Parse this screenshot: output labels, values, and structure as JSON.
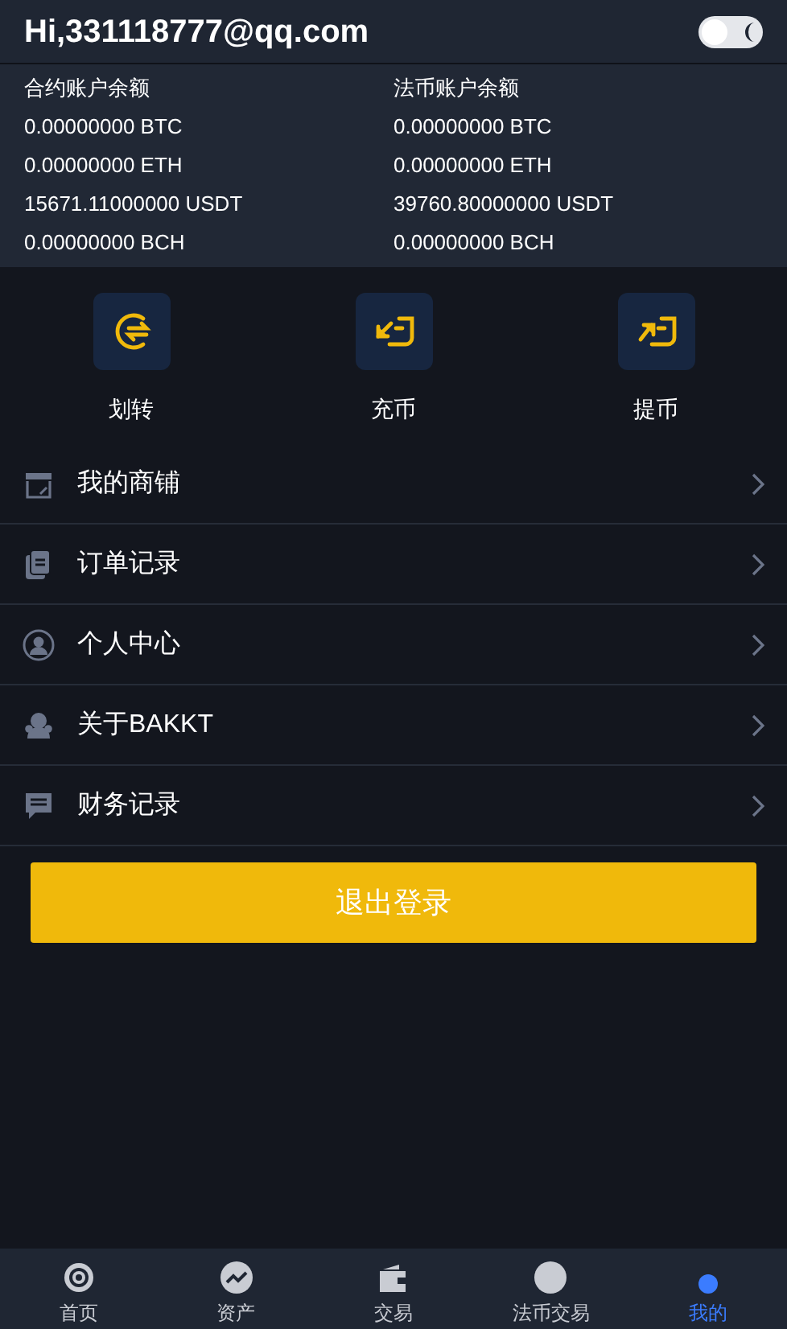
{
  "header": {
    "greeting": "Hi,331118777@qq.com",
    "theme_toggle": {
      "on": false
    }
  },
  "balances": {
    "columns": [
      {
        "title": "合约账户余额",
        "rows": [
          "0.00000000 BTC",
          "0.00000000 ETH",
          "15671.11000000 USDT",
          "0.00000000 BCH"
        ]
      },
      {
        "title": "法币账户余额",
        "rows": [
          "0.00000000 BTC",
          "0.00000000 ETH",
          "39760.80000000 USDT",
          "0.00000000 BCH"
        ]
      }
    ]
  },
  "actions": [
    {
      "label": "划转",
      "kind": "transfer"
    },
    {
      "label": "充币",
      "kind": "deposit"
    },
    {
      "label": "提币",
      "kind": "withdraw"
    }
  ],
  "menu": [
    {
      "label": "我的商铺",
      "kind": "shop"
    },
    {
      "label": "订单记录",
      "kind": "orders"
    },
    {
      "label": "个人中心",
      "kind": "profile"
    },
    {
      "label": "关于BAKKT",
      "kind": "about"
    },
    {
      "label": "财务记录",
      "kind": "finance"
    }
  ],
  "logout_button": "退出登录",
  "bottom_nav": [
    {
      "label": "首页",
      "kind": "home",
      "selected": false
    },
    {
      "label": "资产",
      "kind": "assets",
      "selected": false
    },
    {
      "label": "交易",
      "kind": "trade",
      "selected": false
    },
    {
      "label": "法币交易",
      "kind": "fiat",
      "selected": false
    },
    {
      "label": "我的",
      "kind": "me",
      "selected": true
    }
  ]
}
